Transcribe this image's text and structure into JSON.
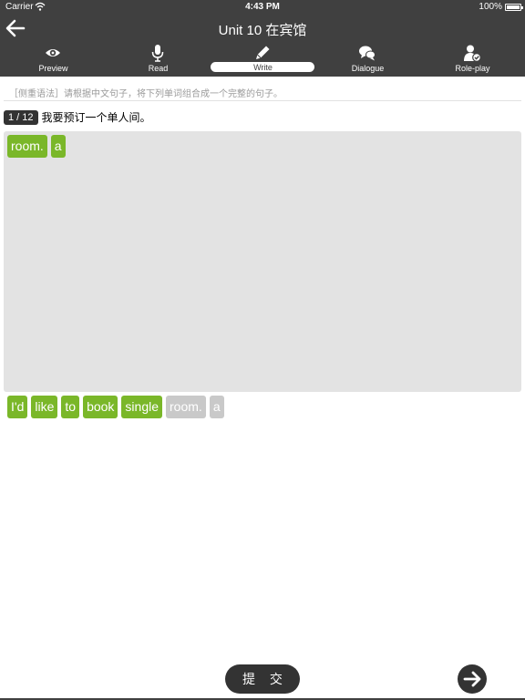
{
  "status": {
    "carrier": "Carrier",
    "time": "4:43 PM",
    "battery": "100%"
  },
  "nav": {
    "title": "Unit 10 在宾馆",
    "tabs": [
      {
        "label": "Preview",
        "icon": "eye-icon"
      },
      {
        "label": "Read",
        "icon": "microphone-icon"
      },
      {
        "label": "Write",
        "icon": "pencil-icon"
      },
      {
        "label": "Dialogue",
        "icon": "chat-bubbles-icon"
      },
      {
        "label": "Role-play",
        "icon": "user-check-icon"
      }
    ],
    "active_tab": "Write"
  },
  "exercise": {
    "hint": "［侧重语法］请根据中文句子，将下列单词组合成一个完整的句子。",
    "counter": "1 / 12",
    "sentence": "我要预订一个单人间。",
    "answer_words": [
      "room.",
      "a"
    ],
    "word_bank": [
      {
        "text": "I'd",
        "used": false
      },
      {
        "text": "like",
        "used": false
      },
      {
        "text": "to",
        "used": false
      },
      {
        "text": "book",
        "used": false
      },
      {
        "text": "single",
        "used": false
      },
      {
        "text": "room.",
        "used": true
      },
      {
        "text": "a",
        "used": true
      }
    ]
  },
  "footer": {
    "submit_label": "提 交"
  },
  "colors": {
    "bar": "#404040",
    "chip": "#7ab729",
    "chip_used": "#c9c9c9",
    "answer_bg": "#e3e3e3"
  }
}
